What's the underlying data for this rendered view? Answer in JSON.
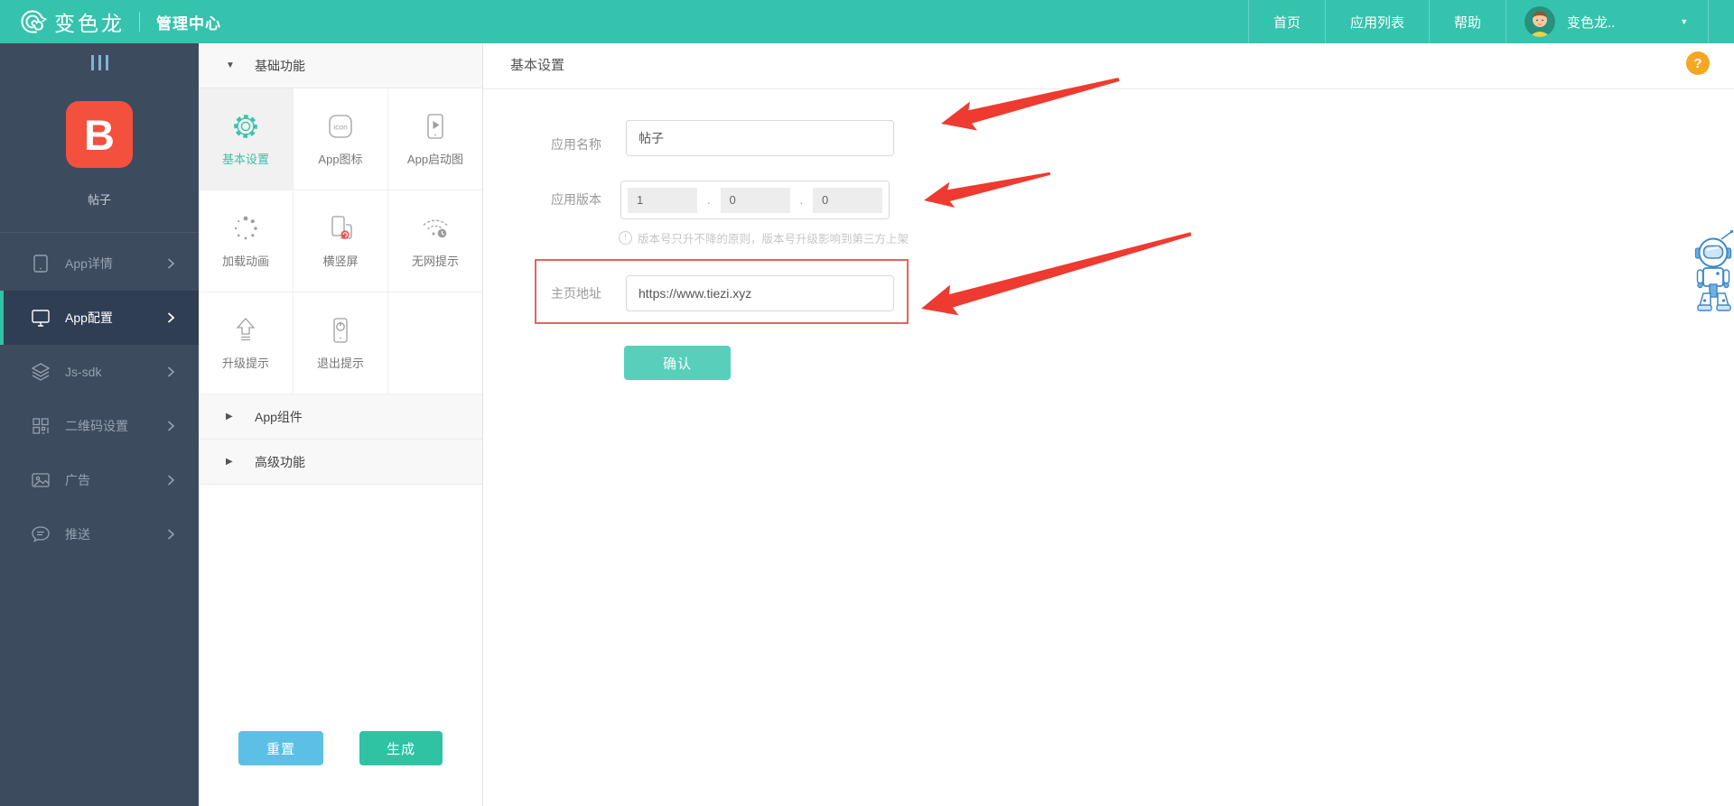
{
  "topbar": {
    "brand": "变色龙",
    "section": "管理中心",
    "nav": [
      {
        "label": "首页"
      },
      {
        "label": "应用列表"
      },
      {
        "label": "帮助"
      }
    ],
    "user": {
      "name": "变色龙.."
    }
  },
  "app_sidebar": {
    "app_initial": "B",
    "app_name": "帖子",
    "items": [
      {
        "label": "App详情"
      },
      {
        "label": "App配置"
      },
      {
        "label": "Js-sdk"
      },
      {
        "label": "二维码设置"
      },
      {
        "label": "广告"
      },
      {
        "label": "推送"
      }
    ]
  },
  "config_sidebar": {
    "section_basic": "基础功能",
    "grid": [
      {
        "label": "基本设置"
      },
      {
        "label": "App图标"
      },
      {
        "label": "App启动图"
      },
      {
        "label": "加载动画"
      },
      {
        "label": "横竖屏"
      },
      {
        "label": "无网提示"
      },
      {
        "label": "升级提示"
      },
      {
        "label": "退出提示"
      }
    ],
    "icon_box_text": "icon",
    "section_components": "App组件",
    "section_advanced": "高级功能",
    "reset_label": "重置",
    "generate_label": "生成"
  },
  "main": {
    "title": "基本设置",
    "app_name_label": "应用名称",
    "app_name_value": "帖子",
    "version_label": "应用版本",
    "version_major": "1",
    "version_minor": "0",
    "version_patch": "0",
    "version_dot": ".",
    "version_hint": "版本号只升不降的原则，版本号升级影响到第三方上架",
    "hint_mark": "!",
    "homepage_label": "主页地址",
    "homepage_value": "https://www.tiezi.xyz",
    "confirm_label": "确认",
    "help_label": "?"
  },
  "icons": {
    "caret_down": "▼",
    "caret_right": "▶",
    "dropdown_caret": "▼"
  },
  "colors": {
    "topbar_teal": "#36c3ad",
    "sidebar_dark": "#3d4b5e",
    "sidebar_active": "#303e54",
    "accent_teal": "#3bc3ab",
    "app_icon_red": "#f3503e",
    "reset_blue": "#5cc0e6",
    "generate_green": "#2fc3a3",
    "confirm_teal": "#58cfba",
    "annotation_red": "#ee3a30",
    "help_orange": "#f5a623"
  }
}
